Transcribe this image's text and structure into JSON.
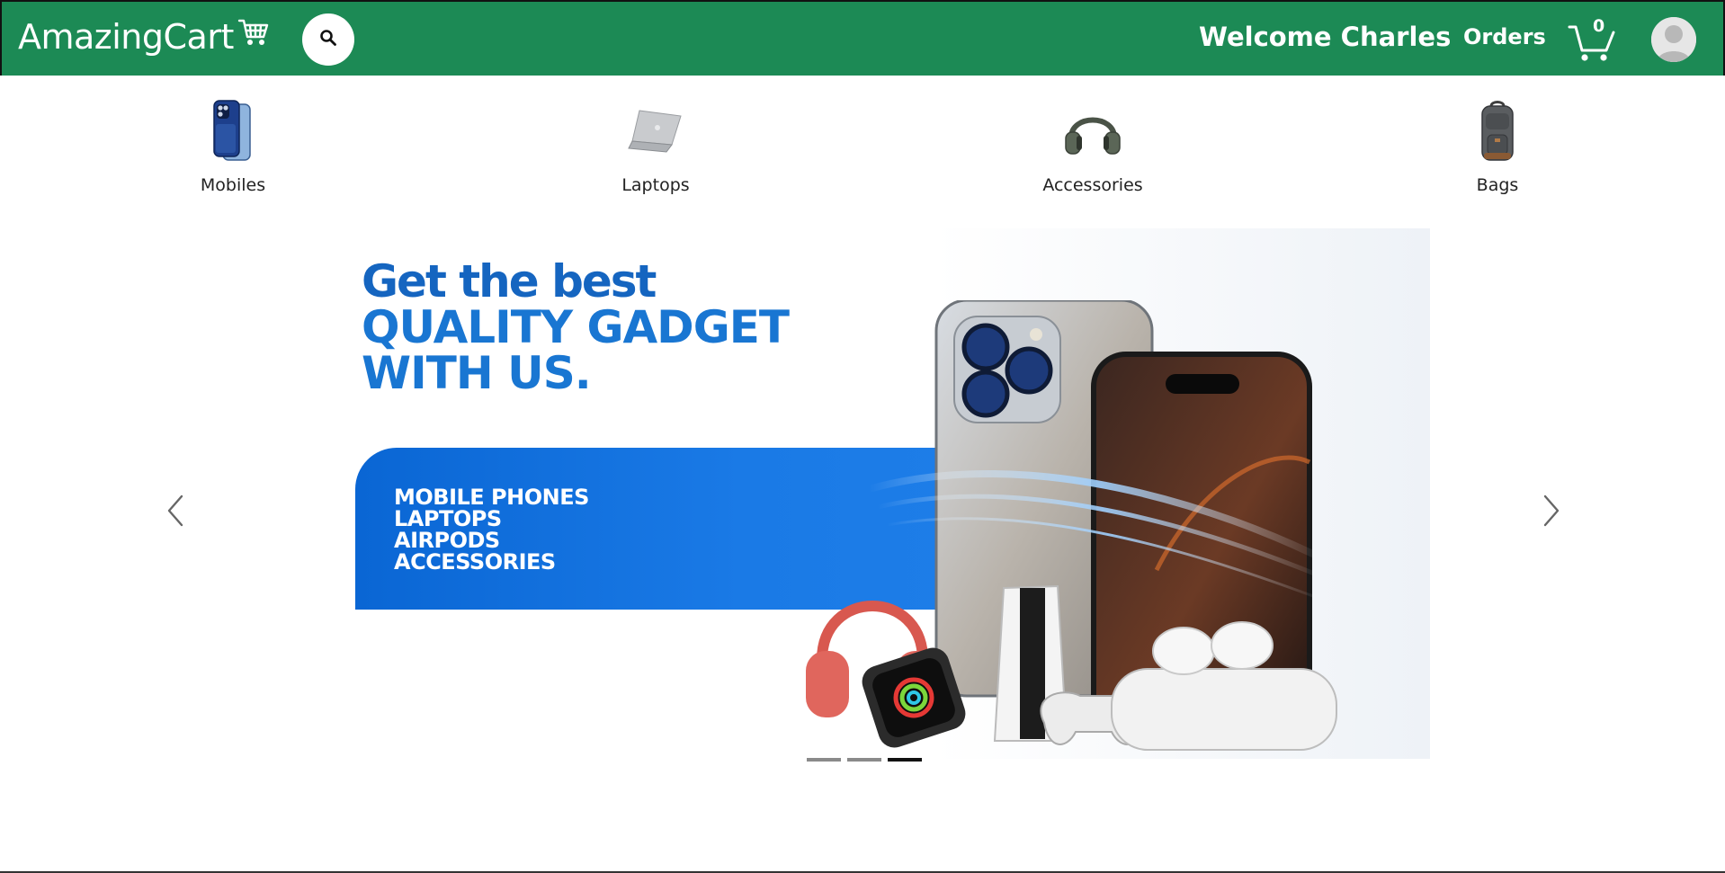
{
  "header": {
    "brand": "AmazingCart",
    "welcome_text": "Welcome Charles",
    "orders_label": "Orders",
    "cart_count": "0",
    "bar_color": "#1c8a55",
    "icons": [
      "cart-logo-icon",
      "search-icon",
      "shopping-cart-icon",
      "user-avatar-icon"
    ]
  },
  "categories": [
    {
      "label": "Mobiles",
      "icon": "mobile-phone-icon"
    },
    {
      "label": "Laptops",
      "icon": "laptop-icon"
    },
    {
      "label": "Accessories",
      "icon": "headphones-icon"
    },
    {
      "label": "Bags",
      "icon": "backpack-icon"
    }
  ],
  "carousel": {
    "slide": {
      "headline_line1": "Get the best",
      "headline_line2": "QUALITY GADGET",
      "headline_line3": "WITH US.",
      "items": [
        "MOBILE PHONES",
        "LAPTOPS",
        "AIRPODS",
        "ACCESSORIES"
      ]
    },
    "slide_count": 3,
    "active_index": 2,
    "accent_color": "#1976d2",
    "icons": [
      "chevron-left-icon",
      "chevron-right-icon"
    ]
  }
}
